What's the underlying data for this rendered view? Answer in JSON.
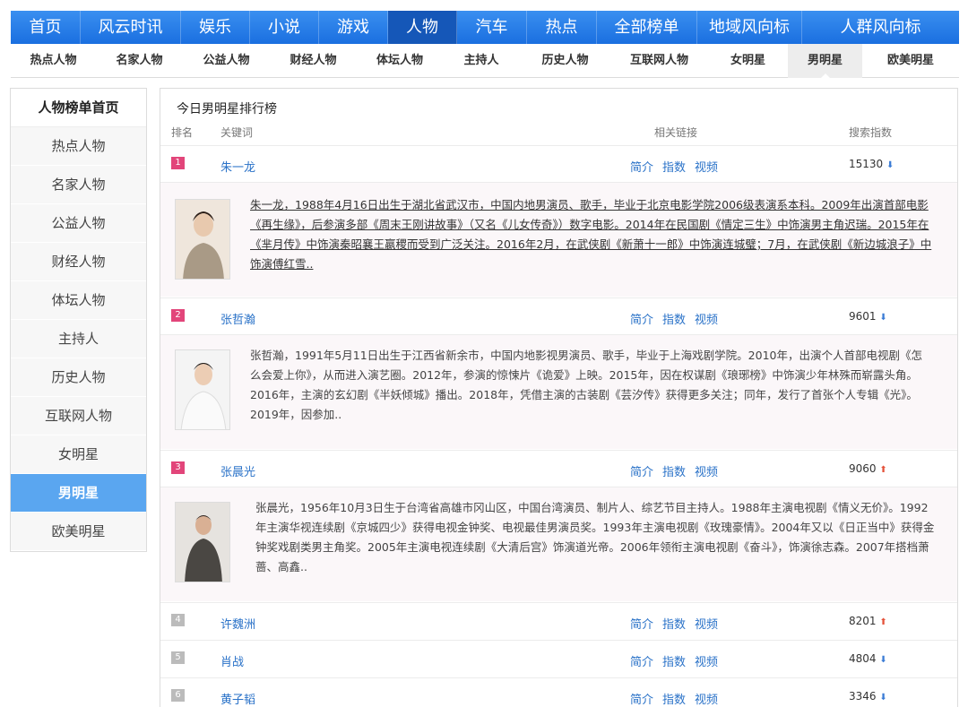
{
  "topnav": [
    "首页",
    "风云时讯",
    "娱乐",
    "小说",
    "游戏",
    "人物",
    "汽车",
    "热点",
    "全部榜单",
    "地域风向标",
    "人群风向标"
  ],
  "subnav": [
    "热点人物",
    "名家人物",
    "公益人物",
    "财经人物",
    "体坛人物",
    "主持人",
    "历史人物",
    "互联网人物",
    "女明星",
    "男明星",
    "欧美明星"
  ],
  "sidebar": {
    "title": "人物榜单首页",
    "items": [
      "热点人物",
      "名家人物",
      "公益人物",
      "财经人物",
      "体坛人物",
      "主持人",
      "历史人物",
      "互联网人物",
      "女明星",
      "男明星",
      "欧美明星"
    ]
  },
  "main": {
    "title": "今日男明星排行榜",
    "col_rank": "排名",
    "col_keyword": "关键词",
    "col_links": "相关链接",
    "col_index": "搜索指数",
    "link_intro": "简介",
    "link_index": "指数",
    "link_video": "视频",
    "arrow_down": "⬇",
    "arrow_up": "⬆",
    "rows": [
      {
        "rank": "1",
        "name": "朱一龙",
        "index": "15130",
        "trend": "down",
        "desc": "朱一龙，1988年4月16日出生于湖北省武汉市，中国内地男演员、歌手，毕业于北京电影学院2006级表演系本科。2009年出演首部电影《再生缘》，后参演多部《周末王刚讲故事》（又名《儿女传奇》）数字电影。2014年在民国剧《情定三生》中饰演男主角迟瑞。2015年在《芈月传》中饰演秦昭襄王嬴稷而受到广泛关注。2016年2月，在武侠剧《新萧十一郎》中饰演连城璧；7月，在武侠剧《新边城浪子》中饰演傅红雪.."
      },
      {
        "rank": "2",
        "name": "张哲瀚",
        "index": "9601",
        "trend": "down",
        "desc": "张哲瀚，1991年5月11日出生于江西省新余市，中国内地影视男演员、歌手，毕业于上海戏剧学院。2010年，出演个人首部电视剧《怎么会爱上你》，从而进入演艺圈。2012年，参演的惊悚片《诡爱》上映。2015年，因在权谋剧《琅琊榜》中饰演少年林殊而崭露头角。2016年，主演的玄幻剧《半妖倾城》播出。2018年，凭借主演的古装剧《芸汐传》获得更多关注；同年，发行了首张个人专辑《光》。2019年，因参加.."
      },
      {
        "rank": "3",
        "name": "张晨光",
        "index": "9060",
        "trend": "up",
        "desc": "张晨光，1956年10月3日生于台湾省高雄市冈山区，中国台湾演员、制片人、综艺节目主持人。1988年主演电视剧《情义无价》。1992年主演华视连续剧《京城四少》获得电视金钟奖、电视最佳男演员奖。1993年主演电视剧《玫瑰豪情》。2004年又以《日正当中》获得金钟奖戏剧类男主角奖。2005年主演电视连续剧《大清后宫》饰演道光帝。2006年领衔主演电视剧《奋斗》，饰演徐志森。2007年搭档萧蔷、高鑫.."
      },
      {
        "rank": "4",
        "name": "许魏洲",
        "index": "8201",
        "trend": "up"
      },
      {
        "rank": "5",
        "name": "肖战",
        "index": "4804",
        "trend": "down"
      },
      {
        "rank": "6",
        "name": "黄子韬",
        "index": "3346",
        "trend": "down"
      }
    ]
  },
  "colors": {
    "nav": "#1a6fe0",
    "nav_active": "#1557b8",
    "side_active": "#5aa6f0",
    "hot_rank": "#e2457a",
    "link": "#2a72c8"
  }
}
